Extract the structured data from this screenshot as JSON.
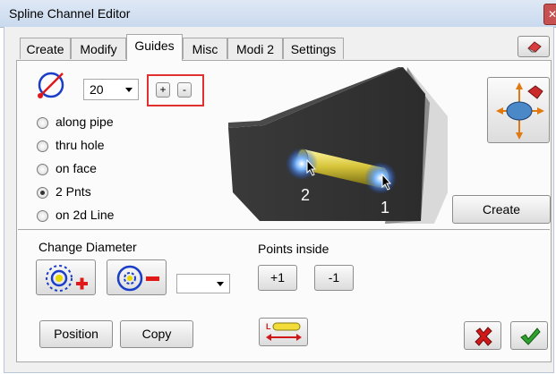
{
  "window": {
    "title": "Spline Channel Editor"
  },
  "tabs": [
    {
      "label": "Create"
    },
    {
      "label": "Modify"
    },
    {
      "label": "Guides"
    },
    {
      "label": "Misc"
    },
    {
      "label": "Modi 2"
    },
    {
      "label": "Settings"
    }
  ],
  "active_tab": "Guides",
  "count_select": {
    "value": "20"
  },
  "increment_buttons": {
    "plus": "+",
    "minus": "-"
  },
  "guide_modes": {
    "options": [
      "along pipe",
      "thru hole",
      "on face",
      "2 Pnts",
      "on 2d Line"
    ],
    "selected": "2 Pnts"
  },
  "preview": {
    "point_labels": [
      "2",
      "1"
    ]
  },
  "buttons": {
    "create": "Create",
    "position": "Position",
    "copy": "Copy"
  },
  "diameter": {
    "label": "Change Diameter",
    "value": ""
  },
  "points_inside": {
    "label": "Points inside",
    "plus": "+1",
    "minus": "-1"
  },
  "icons": [
    "circle-diameter-icon",
    "eraser-icon",
    "navigate-gizmo-icon",
    "diameter-plus-icon",
    "diameter-minus-icon",
    "length-ruler-icon",
    "cancel-icon",
    "ok-icon"
  ],
  "colors": {
    "highlight_box": "#e03030",
    "accent_blue": "#1a3ec8",
    "minus_red": "#e01818",
    "ok_green": "#2fa12f"
  }
}
